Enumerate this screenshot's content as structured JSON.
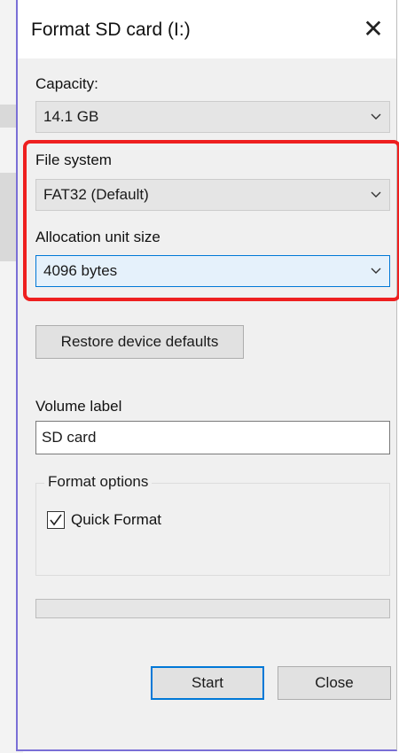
{
  "dialog": {
    "title": "Format SD card (I:)",
    "close_glyph": "✕"
  },
  "capacity": {
    "label": "Capacity:",
    "value": "14.1 GB"
  },
  "file_system": {
    "label": "File system",
    "value": "FAT32 (Default)"
  },
  "allocation": {
    "label": "Allocation unit size",
    "value": "4096 bytes"
  },
  "restore_button": {
    "label": "Restore device defaults"
  },
  "volume": {
    "label": "Volume label",
    "value": "SD card"
  },
  "format_options": {
    "legend": "Format options",
    "quick_format_label": "Quick Format",
    "quick_format_checked": true
  },
  "progress": {
    "fraction": 0
  },
  "buttons": {
    "start": "Start",
    "close": "Close"
  },
  "colors": {
    "highlight": "#ee1f1f",
    "focus": "#0078d7",
    "window_border": "#7a6fd6"
  },
  "icons": {
    "dropdown": "chevron-down-icon",
    "close": "close-icon",
    "check": "checkmark-icon"
  }
}
